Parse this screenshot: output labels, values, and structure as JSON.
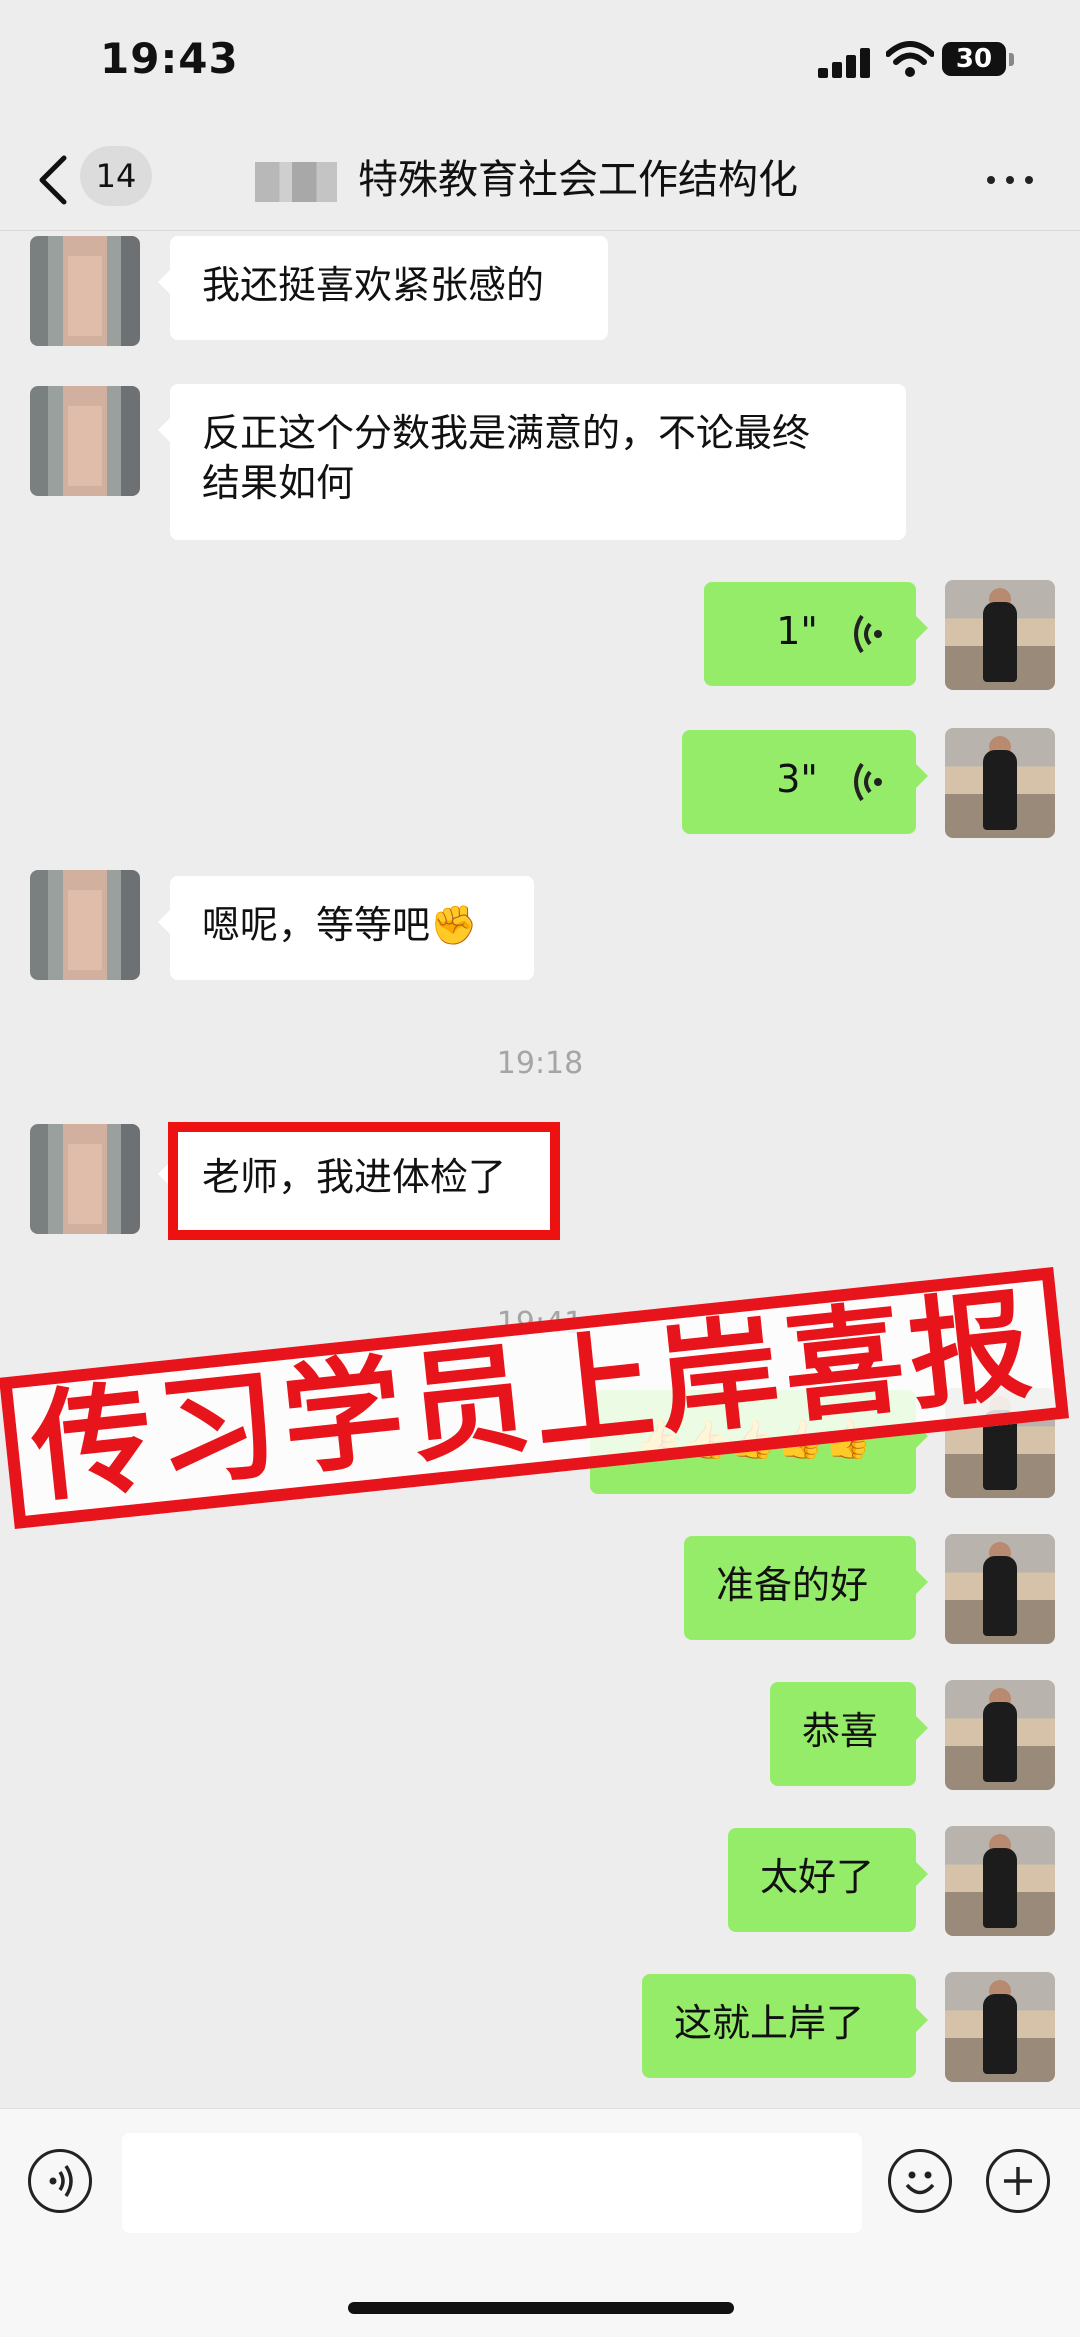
{
  "status_bar": {
    "time": "19:43",
    "battery": "30"
  },
  "header": {
    "unread_count": "14",
    "title": "特殊教育社会工作结构化",
    "more_label": "···"
  },
  "messages": [
    {
      "side": "left",
      "text": "我还挺喜欢紧张感的"
    },
    {
      "side": "left",
      "line1": "反正这个分数我是满意的，不论最终",
      "line2": "结果如何"
    },
    {
      "side": "right",
      "type": "voice",
      "duration": "1\""
    },
    {
      "side": "right",
      "type": "voice",
      "duration": "3\""
    },
    {
      "side": "left",
      "text": "嗯呢，等等吧✊"
    },
    {
      "side": "left",
      "text": "老师，我进体检了"
    },
    {
      "side": "right",
      "text": "👍👍👍👍👍"
    },
    {
      "side": "right",
      "text": "准备的好"
    },
    {
      "side": "right",
      "text": "恭喜"
    },
    {
      "side": "right",
      "text": "太好了"
    },
    {
      "side": "right",
      "text": "这就上岸了"
    }
  ],
  "timestamps": [
    "19:18",
    "19:41"
  ],
  "overlay": {
    "stamp_text": "传习学员上岸喜报",
    "highlight_color": "#ee1111"
  },
  "input_bar": {
    "voice_icon": "voice-icon",
    "emoji_icon": "emoji-icon",
    "plus_icon": "plus-icon"
  },
  "colors": {
    "sent_bubble": "#95ec69",
    "received_bubble": "#ffffff",
    "background": "#ededed"
  }
}
